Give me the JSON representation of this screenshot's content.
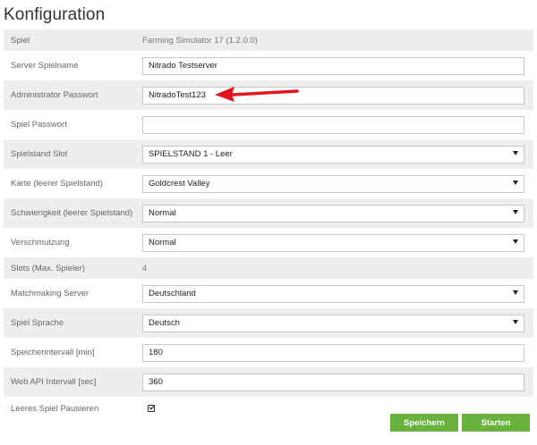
{
  "page": {
    "title": "Konfiguration"
  },
  "fields": [
    {
      "label": "Spiel",
      "kind": "text",
      "value": "Farming Simulator 17 (1.2.0.0)"
    },
    {
      "label": "Server Spielname",
      "kind": "input",
      "value": "Nitrado Testserver"
    },
    {
      "label": "Administrator Passwort",
      "kind": "input",
      "value": "NitradoTest123"
    },
    {
      "label": "Spiel Passwort",
      "kind": "input",
      "value": ""
    },
    {
      "label": "Spielstand Slot",
      "kind": "select",
      "value": "SPIELSTAND 1 - Leer"
    },
    {
      "label": "Karte (leerer Spielstand)",
      "kind": "select",
      "value": "Goldcrest Valley"
    },
    {
      "label": "Schwierigkeit (leerer Spielstand)",
      "kind": "select",
      "value": "Normal"
    },
    {
      "label": "Verschmutzung",
      "kind": "select",
      "value": "Normal"
    },
    {
      "label": "Slots (Max. Spieler)",
      "kind": "text",
      "value": "4"
    },
    {
      "label": "Matchmaking Server",
      "kind": "select",
      "value": "Deutschland"
    },
    {
      "label": "Spiel Sprache",
      "kind": "select",
      "value": "Deutsch"
    },
    {
      "label": "Speicherintervall [min]",
      "kind": "input",
      "value": "180"
    },
    {
      "label": "Web API Intervall [sec]",
      "kind": "input",
      "value": "360"
    },
    {
      "label": "Leeres Spiel Pausieren",
      "kind": "checkbox",
      "checked": true
    }
  ],
  "actions": {
    "save_label": "Speichern",
    "start_label": "Starten"
  },
  "colors": {
    "button_green": "#6ab23e",
    "arrow_red": "#e3141b",
    "row_alt": "#eeeeee"
  }
}
